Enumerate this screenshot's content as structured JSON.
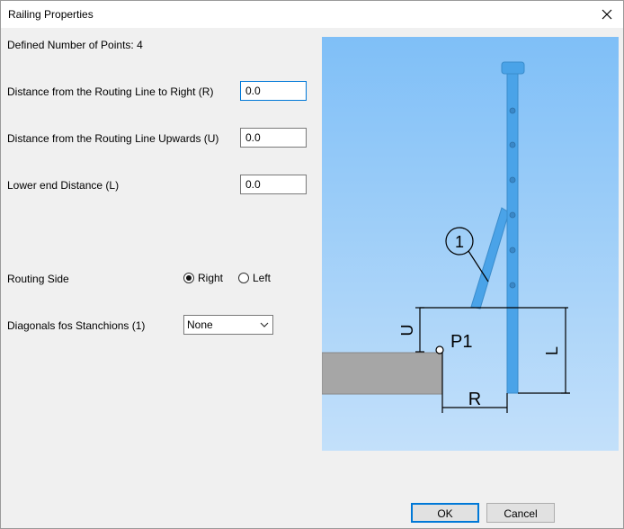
{
  "window": {
    "title": "Railing Properties"
  },
  "form": {
    "defined_points": "Defined Number of Points: 4",
    "distance_right_label": "Distance from the Routing Line to Right (R)",
    "distance_right_value": "0.0",
    "distance_up_label": "Distance from the Routing Line Upwards (U)",
    "distance_up_value": "0.0",
    "lower_end_label": "Lower end Distance (L)",
    "lower_end_value": "0.0",
    "routing_side_label": "Routing Side",
    "routing_side_options": [
      "Right",
      "Left"
    ],
    "routing_side_selected": "Right",
    "diagonals_label": "Diagonals fos Stanchions (1)",
    "diagonals_value": "None"
  },
  "diagram": {
    "callout": "1",
    "point_label": "P1",
    "dim_U": "U",
    "dim_L": "L",
    "dim_R": "R",
    "colors": {
      "bg_top": "#7fbff7",
      "bg_bottom": "#c3e0fa",
      "steel": "#4aa3e8",
      "base": "#a6a6a6"
    }
  },
  "buttons": {
    "ok": "OK",
    "cancel": "Cancel"
  }
}
